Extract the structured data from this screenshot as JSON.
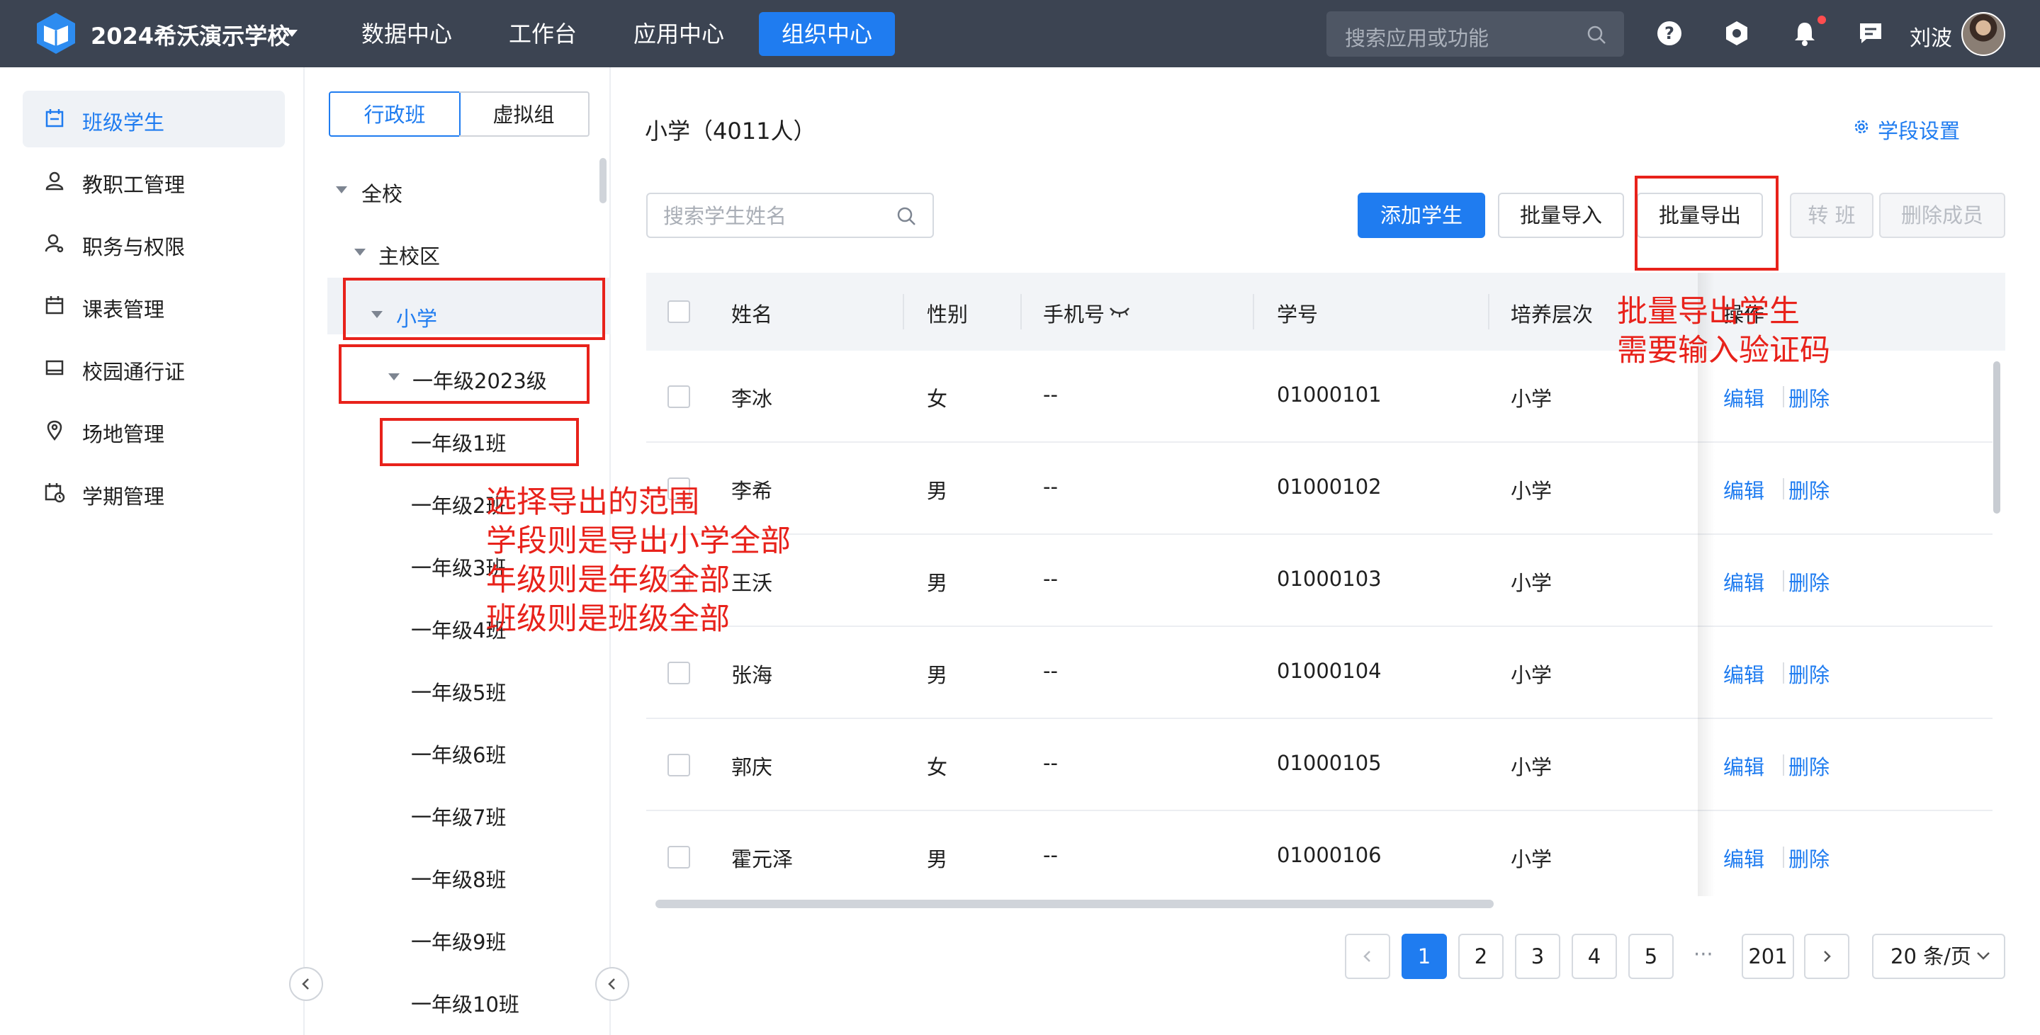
{
  "header": {
    "school_name": "2024希沃演示学校",
    "nav": [
      "数据中心",
      "工作台",
      "应用中心",
      "组织中心"
    ],
    "active_nav": "组织中心",
    "search_placeholder": "搜索应用或功能",
    "user_name": "刘波",
    "icons": [
      "help-icon",
      "settings-icon",
      "bell-icon",
      "message-icon"
    ]
  },
  "sidebar": {
    "items": [
      {
        "label": "班级学生",
        "icon": "class-icon",
        "active": true
      },
      {
        "label": "教职工管理",
        "icon": "user-icon"
      },
      {
        "label": "职务与权限",
        "icon": "user-key-icon"
      },
      {
        "label": "课表管理",
        "icon": "calendar-icon"
      },
      {
        "label": "校园通行证",
        "icon": "card-icon"
      },
      {
        "label": "场地管理",
        "icon": "location-icon"
      },
      {
        "label": "学期管理",
        "icon": "calendar-clock-icon"
      }
    ]
  },
  "tree": {
    "tabs": [
      "行政班",
      "虚拟组"
    ],
    "nodes": {
      "root": "全校",
      "campus": "主校区",
      "stage": "小学",
      "grade": "一年级2023级",
      "classes": [
        "一年级1班",
        "一年级2班",
        "一年级3班",
        "一年级4班",
        "一年级5班",
        "一年级6班",
        "一年级7班",
        "一年级8班",
        "一年级9班",
        "一年级10班"
      ]
    }
  },
  "main": {
    "title": "小学（4011人）",
    "stage_settings": "学段设置",
    "search_placeholder": "搜索学生姓名",
    "buttons": {
      "add": "添加学生",
      "import": "批量导入",
      "export": "批量导出",
      "transfer": "转 班",
      "remove": "删除成员"
    },
    "columns": [
      "姓名",
      "性别",
      "手机号",
      "学号",
      "培养层次",
      "操作"
    ],
    "rows": [
      {
        "name": "李冰",
        "gender": "女",
        "phone": "--",
        "id": "01000101",
        "level": "小学"
      },
      {
        "name": "李希",
        "gender": "男",
        "phone": "--",
        "id": "01000102",
        "level": "小学"
      },
      {
        "name": "王沃",
        "gender": "男",
        "phone": "--",
        "id": "01000103",
        "level": "小学"
      },
      {
        "name": "张海",
        "gender": "男",
        "phone": "--",
        "id": "01000104",
        "level": "小学"
      },
      {
        "name": "郭庆",
        "gender": "女",
        "phone": "--",
        "id": "01000105",
        "level": "小学"
      },
      {
        "name": "霍元泽",
        "gender": "男",
        "phone": "--",
        "id": "01000106",
        "level": "小学"
      }
    ],
    "actions": {
      "edit": "编辑",
      "delete": "删除"
    }
  },
  "pagination": {
    "pages": [
      "1",
      "2",
      "3",
      "4",
      "5"
    ],
    "current": "1",
    "ellipsis": "···",
    "last": "201",
    "page_size": "20 条/页"
  },
  "annotations": {
    "export_note": [
      "批量导出学生",
      "需要输入验证码"
    ],
    "scope_note": [
      "选择导出的范围",
      "学段则是导出小学全部",
      "年级则是年级全部",
      "班级则是班级全部"
    ]
  },
  "colors": {
    "accent": "#1f7cf0",
    "topbar": "#3c4452",
    "annotation": "#e8221b"
  }
}
